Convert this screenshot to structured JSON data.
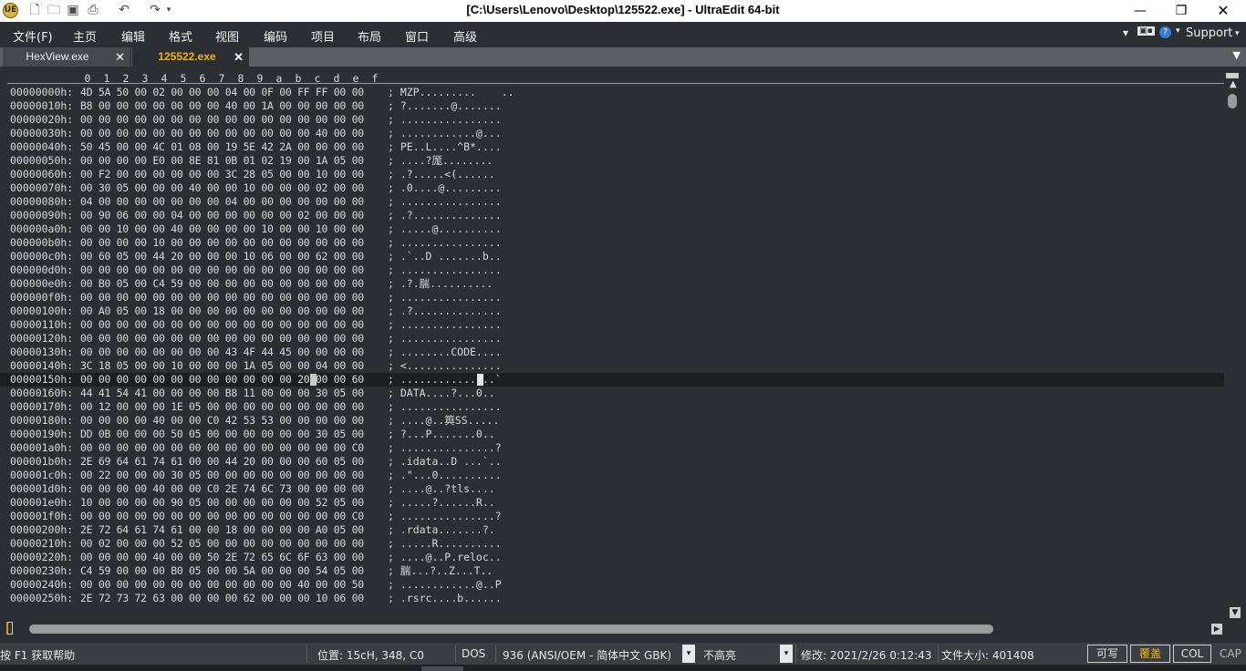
{
  "window": {
    "title": "[C:\\Users\\Lenovo\\Desktop\\125522.exe] - UltraEdit 64-bit",
    "minimize_icon": "minimize-icon",
    "restore_icon": "restore-icon",
    "close_icon": "close-icon"
  },
  "quick_access": [
    "new-file-icon",
    "open-folder-icon",
    "save-icon",
    "print-icon",
    "undo-icon",
    "redo-icon",
    "customize-icon"
  ],
  "menu": {
    "items": [
      "文件(F)",
      "主页",
      "编辑",
      "格式",
      "视图",
      "编码",
      "项目",
      "布局",
      "窗口",
      "高级"
    ],
    "support": "Support"
  },
  "tabs": [
    {
      "label": "HexView.exe",
      "active": false
    },
    {
      "label": "125522.exe",
      "active": true
    }
  ],
  "ruler": [
    "0",
    "1",
    "2",
    "3",
    "4",
    "5",
    "6",
    "7",
    "8",
    "9",
    "a",
    "b",
    "c",
    "d",
    "e",
    "f"
  ],
  "hex_rows": [
    {
      "addr": "00000000h:",
      "hex": "4D 5A 50 00 02 00 00 00 04 00 0F 00 FF FF 00 00",
      "ascii": "; MZP.........    .."
    },
    {
      "addr": "00000010h:",
      "hex": "B8 00 00 00 00 00 00 00 40 00 1A 00 00 00 00 00",
      "ascii": "; ?.......@......."
    },
    {
      "addr": "00000020h:",
      "hex": "00 00 00 00 00 00 00 00 00 00 00 00 00 00 00 00",
      "ascii": "; ................"
    },
    {
      "addr": "00000030h:",
      "hex": "00 00 00 00 00 00 00 00 00 00 00 00 00 40 00 00",
      "ascii": "; ............@..."
    },
    {
      "addr": "00000040h:",
      "hex": "50 45 00 00 4C 01 08 00 19 5E 42 2A 00 00 00 00",
      "ascii": "; PE..L....^B*...."
    },
    {
      "addr": "00000050h:",
      "hex": "00 00 00 00 E0 00 8E 81 0B 01 02 19 00 1A 05 00",
      "ascii": "; ....?厖........"
    },
    {
      "addr": "00000060h:",
      "hex": "00 F2 00 00 00 00 00 00 3C 28 05 00 00 10 00 00",
      "ascii": "; .?.....<(......"
    },
    {
      "addr": "00000070h:",
      "hex": "00 30 05 00 00 00 40 00 00 10 00 00 00 02 00 00",
      "ascii": "; .0....@........."
    },
    {
      "addr": "00000080h:",
      "hex": "04 00 00 00 00 00 00 00 04 00 00 00 00 00 00 00",
      "ascii": "; ................"
    },
    {
      "addr": "00000090h:",
      "hex": "00 90 06 00 00 04 00 00 00 00 00 00 02 00 00 00",
      "ascii": "; .?.............."
    },
    {
      "addr": "000000a0h:",
      "hex": "00 00 10 00 00 40 00 00 00 00 10 00 00 10 00 00",
      "ascii": "; .....@.........."
    },
    {
      "addr": "000000b0h:",
      "hex": "00 00 00 00 10 00 00 00 00 00 00 00 00 00 00 00",
      "ascii": "; ................"
    },
    {
      "addr": "000000c0h:",
      "hex": "00 60 05 00 44 20 00 00 00 10 06 00 00 62 00 00",
      "ascii": "; .`..D .......b.."
    },
    {
      "addr": "000000d0h:",
      "hex": "00 00 00 00 00 00 00 00 00 00 00 00 00 00 00 00",
      "ascii": "; ................"
    },
    {
      "addr": "000000e0h:",
      "hex": "00 B0 05 00 C4 59 00 00 00 00 00 00 00 00 00 00",
      "ascii": "; .?.腨.........."
    },
    {
      "addr": "000000f0h:",
      "hex": "00 00 00 00 00 00 00 00 00 00 00 00 00 00 00 00",
      "ascii": "; ................"
    },
    {
      "addr": "00000100h:",
      "hex": "00 A0 05 00 18 00 00 00 00 00 00 00 00 00 00 00",
      "ascii": "; .?.............."
    },
    {
      "addr": "00000110h:",
      "hex": "00 00 00 00 00 00 00 00 00 00 00 00 00 00 00 00",
      "ascii": "; ................"
    },
    {
      "addr": "00000120h:",
      "hex": "00 00 00 00 00 00 00 00 00 00 00 00 00 00 00 00",
      "ascii": "; ................"
    },
    {
      "addr": "00000130h:",
      "hex": "00 00 00 00 00 00 00 00 43 4F 44 45 00 00 00 00",
      "ascii": "; ........CODE...."
    },
    {
      "addr": "00000140h:",
      "hex": "3C 18 05 00 00 10 00 00 00 1A 05 00 00 04 00 00",
      "ascii": "; <..............."
    },
    {
      "addr": "00000150h:",
      "hex": "00 00 00 00 00 00 00 00 00 00 00 00 20 00 00 60",
      "ascii": "; ............ ..`"
    },
    {
      "addr": "00000160h:",
      "hex": "44 41 54 41 00 00 00 00 B8 11 00 00 00 30 05 00",
      "ascii": "; DATA....?...0.."
    },
    {
      "addr": "00000170h:",
      "hex": "00 12 00 00 00 1E 05 00 00 00 00 00 00 00 00 00",
      "ascii": "; ................"
    },
    {
      "addr": "00000180h:",
      "hex": "00 00 00 00 40 00 00 C0 42 53 53 00 00 00 00 00",
      "ascii": "; ....@..籅SS....."
    },
    {
      "addr": "00000190h:",
      "hex": "DD 0B 00 00 00 50 05 00 00 00 00 00 00 30 05 00",
      "ascii": "; ?...P.......0.."
    },
    {
      "addr": "000001a0h:",
      "hex": "00 00 00 00 00 00 00 00 00 00 00 00 00 00 00 C0",
      "ascii": "; ...............?"
    },
    {
      "addr": "000001b0h:",
      "hex": "2E 69 64 61 74 61 00 00 44 20 00 00 00 60 05 00",
      "ascii": "; .idata..D ...`.."
    },
    {
      "addr": "000001c0h:",
      "hex": "00 22 00 00 00 30 05 00 00 00 00 00 00 00 00 00",
      "ascii": "; .\"...0.........."
    },
    {
      "addr": "000001d0h:",
      "hex": "00 00 00 00 40 00 00 C0 2E 74 6C 73 00 00 00 00",
      "ascii": "; ....@..?tls...."
    },
    {
      "addr": "000001e0h:",
      "hex": "10 00 00 00 00 90 05 00 00 00 00 00 00 52 05 00",
      "ascii": "; .....?......R.."
    },
    {
      "addr": "000001f0h:",
      "hex": "00 00 00 00 00 00 00 00 00 00 00 00 00 00 00 C0",
      "ascii": "; ...............?"
    },
    {
      "addr": "00000200h:",
      "hex": "2E 72 64 61 74 61 00 00 18 00 00 00 00 A0 05 00",
      "ascii": "; .rdata.......?."
    },
    {
      "addr": "00000210h:",
      "hex": "00 02 00 00 00 52 05 00 00 00 00 00 00 00 00 00",
      "ascii": "; .....R.........."
    },
    {
      "addr": "00000220h:",
      "hex": "00 00 00 00 40 00 00 50 2E 72 65 6C 6F 63 00 00",
      "ascii": "; ....@..P.reloc.."
    },
    {
      "addr": "00000230h:",
      "hex": "C4 59 00 00 00 B0 05 00 00 5A 00 00 00 54 05 00",
      "ascii": "; 腨...?..Z...T.."
    },
    {
      "addr": "00000240h:",
      "hex": "00 00 00 00 00 00 00 00 00 00 00 00 40 00 00 50",
      "ascii": "; ............@..P"
    },
    {
      "addr": "00000250h:",
      "hex": "2E 72 73 72 63 00 00 00 00 62 00 00 00 10 06 00",
      "ascii": "; .rsrc....b......"
    }
  ],
  "current_row_index": 21,
  "status": {
    "help": "按 F1 获取帮助",
    "position": "位置: 15cH, 348, C0",
    "line_ending": "DOS",
    "codepage": "936   (ANSI/OEM - 简体中文 GBK)",
    "highlight": "不高亮",
    "modified": "修改:   2021/2/26 0:12:43",
    "filesize": "文件大小:   401408",
    "writable": "可写",
    "overwrite": "覆盖",
    "col": "COL",
    "cap": "CAP"
  },
  "colors": {
    "background": "#2b2f33",
    "active_tab_text": "#f3b400",
    "overwrite_text": "#f3b400",
    "current_line": "#1c1f22"
  }
}
